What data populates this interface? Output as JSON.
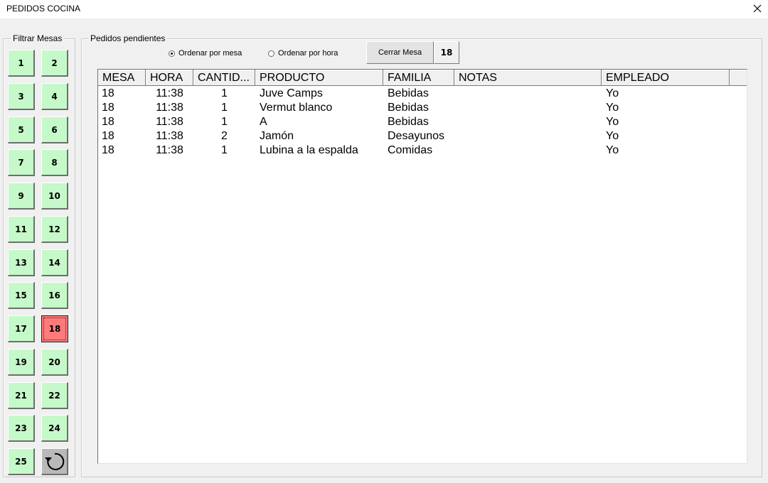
{
  "window": {
    "title": "PEDIDOS COCINA",
    "close_icon": "close-icon"
  },
  "filter": {
    "legend": "Filtrar Mesas",
    "tables": [
      "1",
      "2",
      "3",
      "4",
      "5",
      "6",
      "7",
      "8",
      "9",
      "10",
      "11",
      "12",
      "13",
      "14",
      "15",
      "16",
      "17",
      "18",
      "19",
      "20",
      "21",
      "22",
      "23",
      "24",
      "25"
    ],
    "selected_table": "18",
    "reset_icon": "refresh-icon",
    "colors": {
      "button": "#c5f9c9",
      "selected": "#ff7b7b",
      "reset": "#b9b9b9"
    }
  },
  "orders": {
    "legend": "Pedidos pendientes",
    "sort_options": [
      {
        "label": "Ordenar por mesa",
        "checked": true
      },
      {
        "label": "Ordenar por hora",
        "checked": false
      }
    ],
    "close_button_label": "Cerrar Mesa",
    "current_table": "18",
    "columns": [
      "MESA",
      "HORA",
      "CANTID...",
      "PRODUCTO",
      "FAMILIA",
      "NOTAS",
      "EMPLEADO"
    ],
    "rows": [
      [
        "18",
        "11:38",
        "1",
        "Juve Camps",
        "Bebidas",
        "",
        "Yo"
      ],
      [
        "18",
        "11:38",
        "1",
        "Vermut blanco",
        "Bebidas",
        "",
        "Yo"
      ],
      [
        "18",
        "11:38",
        "1",
        "A",
        "Bebidas",
        "",
        "Yo"
      ],
      [
        "18",
        "11:38",
        "2",
        "Jamón",
        "Desayunos",
        "",
        "Yo"
      ],
      [
        "18",
        "11:38",
        "1",
        "Lubina a la espalda",
        "Comidas",
        "",
        "Yo"
      ]
    ]
  }
}
